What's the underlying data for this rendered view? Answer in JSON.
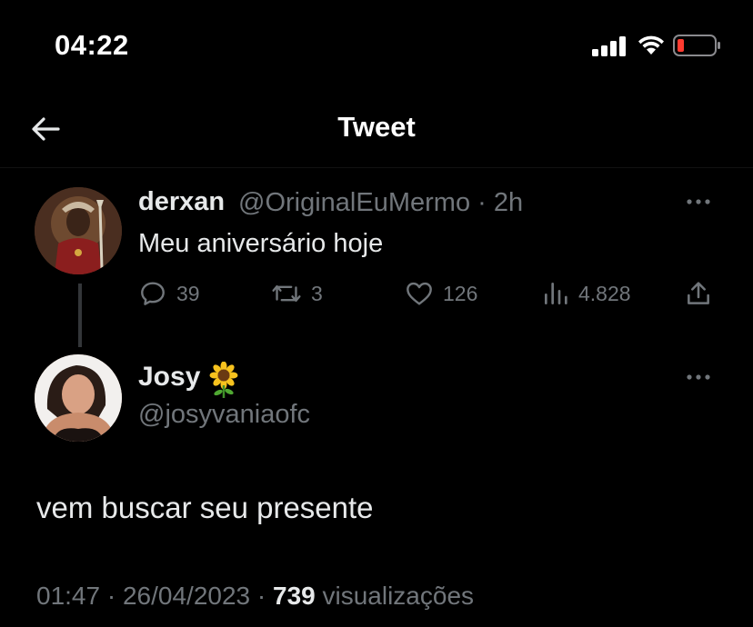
{
  "status_bar": {
    "time": "04:22",
    "icons": [
      "cellular-signal-icon",
      "wifi-icon",
      "battery-low-icon"
    ],
    "battery_color": "#ff3b30"
  },
  "header": {
    "title": "Tweet",
    "back_icon": "arrow-left-icon"
  },
  "parent_tweet": {
    "display_name": "derxan",
    "handle": "@OriginalEuMermo",
    "separator": "·",
    "time_ago": "2h",
    "text": "Meu aniversário hoje",
    "actions": {
      "replies": "39",
      "retweets": "3",
      "likes": "126",
      "views": "4.828"
    }
  },
  "main_tweet": {
    "display_name": "Josy",
    "name_emoji": "sunflower",
    "handle": "@josyvaniaofc",
    "text": "vem buscar seu presente",
    "time": "01:47",
    "separator": "·",
    "date": "26/04/2023",
    "views_count": "739",
    "views_label": "visualizações"
  },
  "colors": {
    "background": "#000000",
    "primary_text": "#e7e9ea",
    "secondary_text": "#71767b",
    "thread_line": "#333639"
  }
}
